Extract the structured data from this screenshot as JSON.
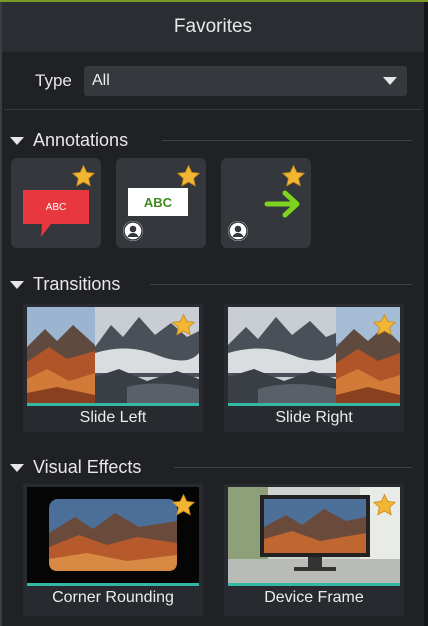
{
  "header": {
    "title": "Favorites"
  },
  "filter": {
    "label": "Type",
    "selected": "All"
  },
  "annotations": {
    "title": "Annotations",
    "items": [
      {
        "name": "red-callout",
        "text": "ABC",
        "favorite": true,
        "user": false
      },
      {
        "name": "text-box",
        "text": "ABC",
        "favorite": true,
        "user": true
      },
      {
        "name": "green-arrow",
        "favorite": true,
        "user": true
      }
    ]
  },
  "transitions": {
    "title": "Transitions",
    "items": [
      {
        "label": "Slide Left",
        "favorite": true
      },
      {
        "label": "Slide Right",
        "favorite": true
      }
    ]
  },
  "visual_effects": {
    "title": "Visual Effects",
    "items": [
      {
        "label": "Corner Rounding",
        "favorite": true
      },
      {
        "label": "Device Frame",
        "favorite": true
      }
    ]
  },
  "colors": {
    "accent_bar": "#33b8a4",
    "star": "#f2b632",
    "callout_red": "#e8373e",
    "arrow_green": "#7ed321"
  },
  "icons": [
    "star-icon",
    "user-icon",
    "caret-down-icon"
  ]
}
